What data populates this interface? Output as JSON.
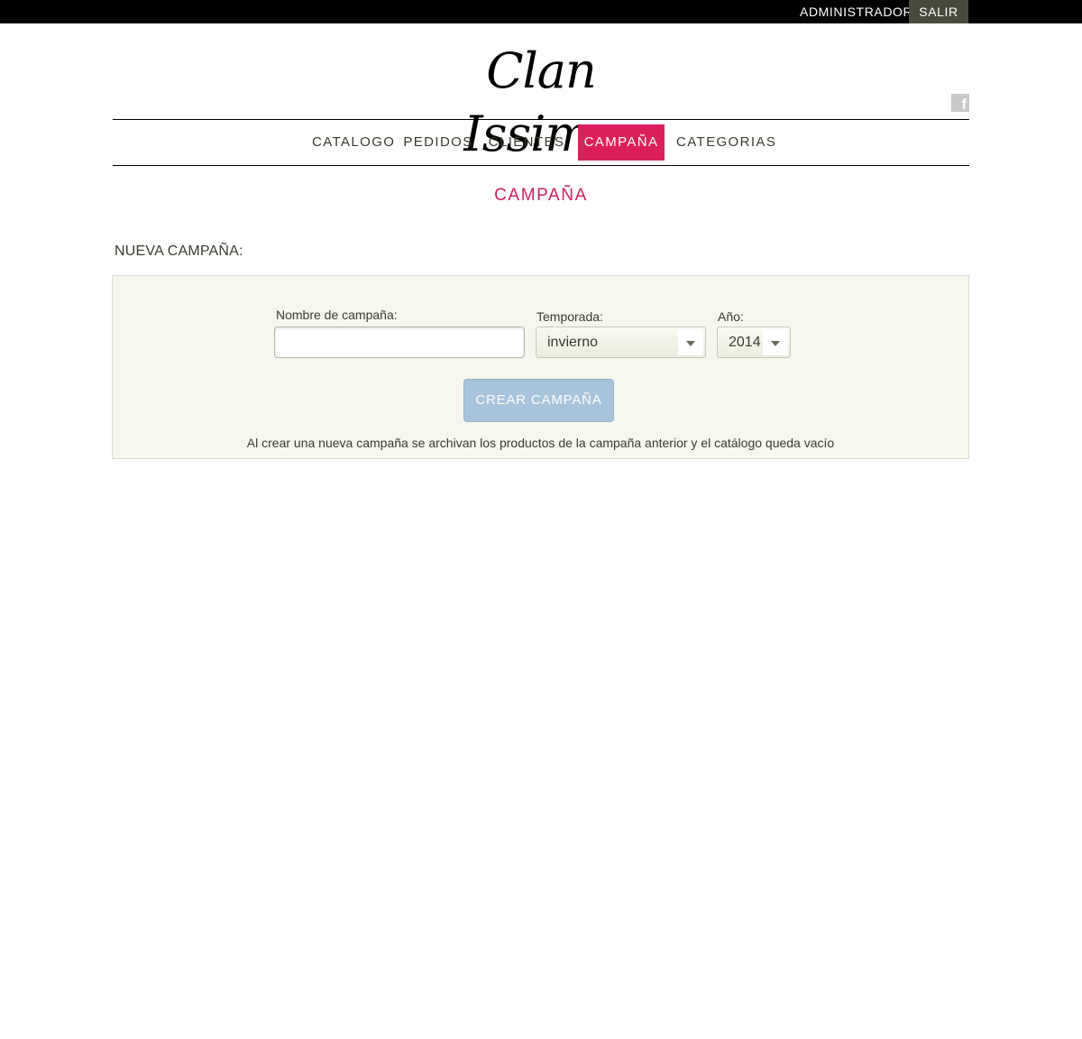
{
  "topbar": {
    "user_label": "ADMINISTRADOR",
    "logout_label": "SALIR"
  },
  "brand": {
    "logo_text": "Clan Issime",
    "social_icon": "facebook-icon"
  },
  "nav": {
    "items": [
      {
        "label": "CATALOGO",
        "active": false
      },
      {
        "label": "PEDIDOS",
        "active": false
      },
      {
        "label": "CLIENTES",
        "active": false
      },
      {
        "label": "CAMPAÑA",
        "active": true
      },
      {
        "label": "CATEGORIAS",
        "active": false
      }
    ]
  },
  "page": {
    "title": "CAMPAÑA",
    "section_title": "NUEVA CAMPAÑA:"
  },
  "form": {
    "name_label": "Nombre de campaña:",
    "name_value": "",
    "season_label": "Temporada:",
    "season_value": "invierno",
    "year_label": "Año:",
    "year_value": "2014",
    "submit_label": "CREAR CAMPAÑA",
    "note": "Al crear una nueva campaña se archivan los productos de la campaña anterior y el catálogo queda vacío"
  },
  "colors": {
    "accent": "#dc1f5a",
    "title": "#d01f58",
    "button": "#a7c4dc",
    "topbar": "#000000",
    "form_bg": "#f7f7ef"
  }
}
